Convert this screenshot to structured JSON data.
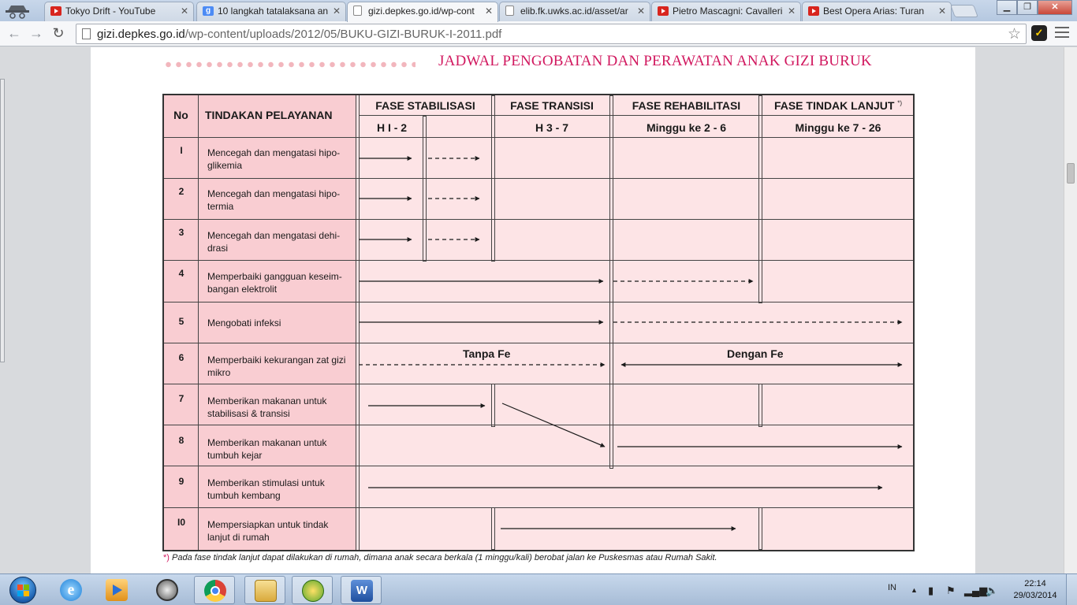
{
  "browser": {
    "tabs": [
      {
        "label": "Tokyo Drift - YouTube",
        "icon": "youtube-icon",
        "active": false
      },
      {
        "label": "10 langkah tatalaksana an",
        "icon": "google-icon",
        "active": false
      },
      {
        "label": "gizi.depkes.go.id/wp-cont",
        "icon": "page-icon",
        "active": true
      },
      {
        "label": "elib.fk.uwks.ac.id/asset/ar",
        "icon": "page-icon",
        "active": false
      },
      {
        "label": "Pietro Mascagni: Cavalleri",
        "icon": "youtube-icon",
        "active": false
      },
      {
        "label": "Best Opera Arias: Turan",
        "icon": "youtube-icon",
        "active": false
      }
    ],
    "url_host": "gizi.depkes.go.id",
    "url_path": "/wp-content/uploads/2012/05/BUKU-GIZI-BURUK-I-2011.pdf"
  },
  "document": {
    "title": "JADWAL PENGOBATAN DAN PERAWATAN ANAK GIZI BURUK",
    "table": {
      "col_no": "No",
      "col_action": "TINDAKAN PELAYANAN",
      "phases": [
        {
          "name": "FASE STABILISASI",
          "period": "H I - 2"
        },
        {
          "name": "FASE TRANSISI",
          "period": "H 3 - 7"
        },
        {
          "name": "FASE REHABILITASI",
          "period": "Minggu ke 2 - 6"
        },
        {
          "name": "FASE TINDAK LANJUT",
          "period": "Minggu ke 7 - 26",
          "marker": "*)"
        }
      ],
      "rows": [
        {
          "no": "I",
          "action_lines": [
            "Mencegah dan mengatasi hipo-",
            "glikemia"
          ]
        },
        {
          "no": "2",
          "action_lines": [
            "Mencegah dan mengatasi hipo-",
            "termia"
          ]
        },
        {
          "no": "3",
          "action_lines": [
            "Mencegah dan mengatasi dehi-",
            "drasi"
          ]
        },
        {
          "no": "4",
          "action_lines": [
            "Memperbaiki gangguan keseim-",
            "bangan elektrolit"
          ]
        },
        {
          "no": "5",
          "action_lines": [
            "Mengobati infeksi"
          ]
        },
        {
          "no": "6",
          "action_lines": [
            "Memperbaiki kekurangan zat gizi",
            "mikro"
          ]
        },
        {
          "no": "7",
          "action_lines": [
            "Memberikan makanan untuk",
            "stabilisasi & transisi"
          ]
        },
        {
          "no": "8",
          "action_lines": [
            "Memberikan makanan untuk",
            "tumbuh kejar"
          ]
        },
        {
          "no": "9",
          "action_lines": [
            "Memberikan stimulasi untuk",
            "tumbuh kembang"
          ]
        },
        {
          "no": "I0",
          "action_lines": [
            "Mempersiapkan untuk tindak",
            "lanjut di rumah"
          ]
        }
      ],
      "label_tanpa_fe": "Tanpa Fe",
      "label_dengan_fe": "Dengan Fe"
    },
    "footnote_marker": "*)",
    "footnote": "Pada fase tindak lanjut dapat dilakukan di rumah, dimana anak secara berkala (1 minggu/kali) berobat jalan ke Puskesmas atau Rumah Sakit."
  },
  "taskbar": {
    "apps": [
      "internet-explorer-icon",
      "media-player-icon",
      "clock-app-icon",
      "chrome-icon",
      "file-explorer-icon",
      "network-app-icon",
      "word-icon"
    ],
    "language": "IN",
    "time": "22:14",
    "date": "29/03/2014"
  }
}
